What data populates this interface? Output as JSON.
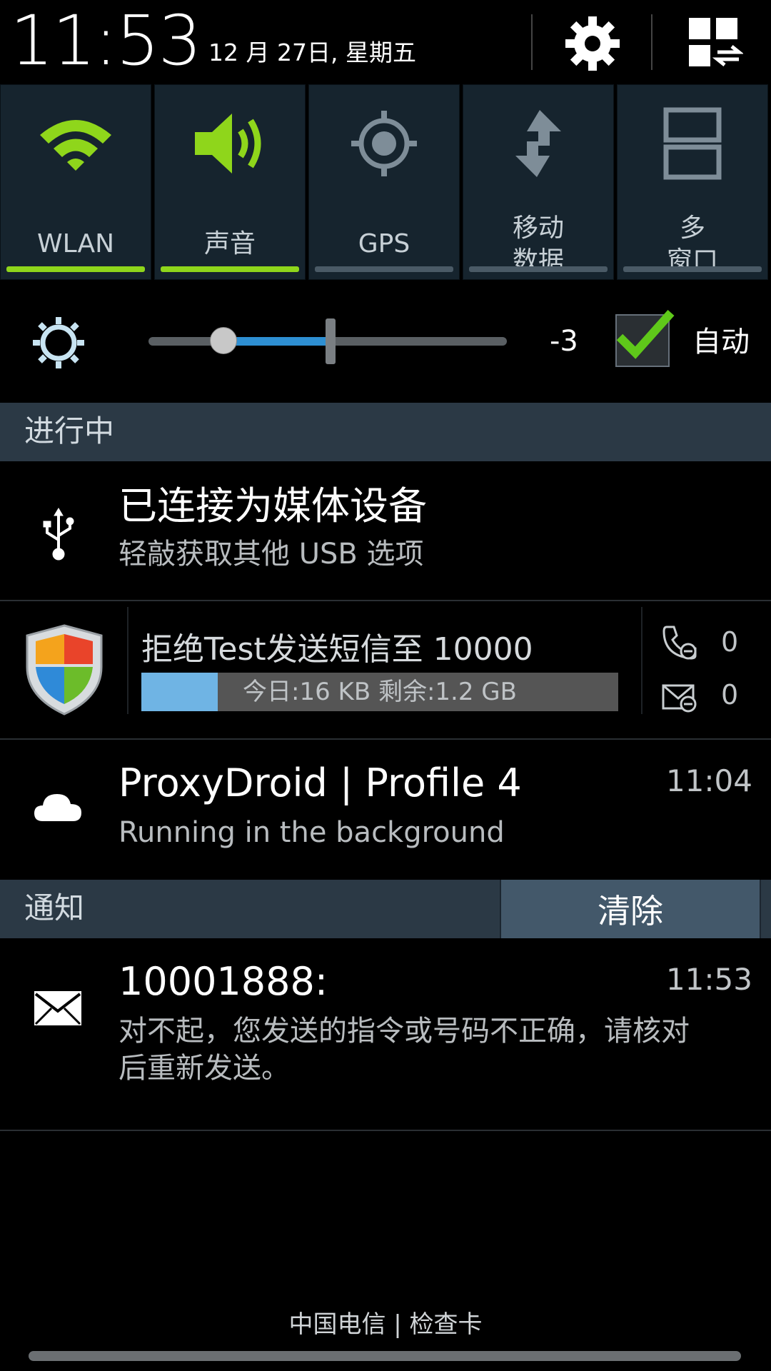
{
  "status": {
    "time": "11:53",
    "date": "12 月 27日, 星期五"
  },
  "quick_settings": [
    {
      "label": "WLAN",
      "active": true,
      "icon": "wifi-icon"
    },
    {
      "label": "声音",
      "active": true,
      "icon": "volume-icon"
    },
    {
      "label": "GPS",
      "active": false,
      "icon": "gps-icon"
    },
    {
      "label_line1": "移动",
      "label_line2": "数据",
      "active": false,
      "icon": "mobile-data-icon"
    },
    {
      "label_line1": "多",
      "label_line2": "窗口",
      "active": false,
      "icon": "multi-window-icon"
    }
  ],
  "brightness": {
    "value": "-3",
    "auto_label": "自动",
    "auto_checked": true
  },
  "ongoing": {
    "header": "进行中",
    "usb": {
      "title": "已连接为媒体设备",
      "subtitle": "轻敲获取其他 USB 选项"
    },
    "security": {
      "title": "拒绝Test发送短信至 10000",
      "usage": "今日:16 KB 剩余:1.2 GB",
      "usage_fraction": 0.16,
      "call_count": "0",
      "sms_count": "0"
    },
    "proxy": {
      "title": "ProxyDroid | Profile 4",
      "subtitle": "Running in the background",
      "time": "11:04"
    }
  },
  "notifications": {
    "header": "通知",
    "clear_label": "清除",
    "sms": {
      "sender": "10001888:",
      "time": "11:53",
      "body_line1": "对不起，您发送的指令或号码不正确，请核对",
      "body_line2": "后重新发送。"
    }
  },
  "carrier": "中国电信 | 检查卡",
  "colors": {
    "active_green": "#8fd61b",
    "tile_bg": "#16242e",
    "section_bg": "#2b3945",
    "slider_blue": "#2e8fd2"
  }
}
